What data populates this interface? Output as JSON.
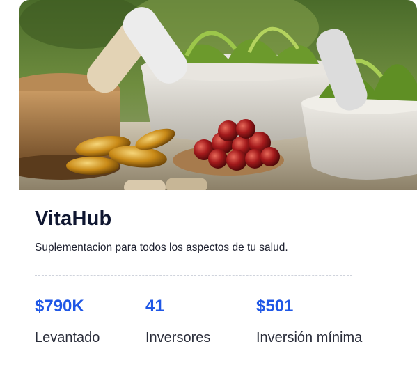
{
  "project": {
    "name": "VitaHub",
    "description": "Suplementacion para todos los aspectos de tu salud."
  },
  "stats": [
    {
      "value": "$790K",
      "label": "Levantado"
    },
    {
      "value": "41",
      "label": "Inversores"
    },
    {
      "value": "$501",
      "label": "Inversión mínima"
    }
  ],
  "colors": {
    "accent": "#1f57e6",
    "title": "#0f1630",
    "divider": "#cfd3dc"
  }
}
